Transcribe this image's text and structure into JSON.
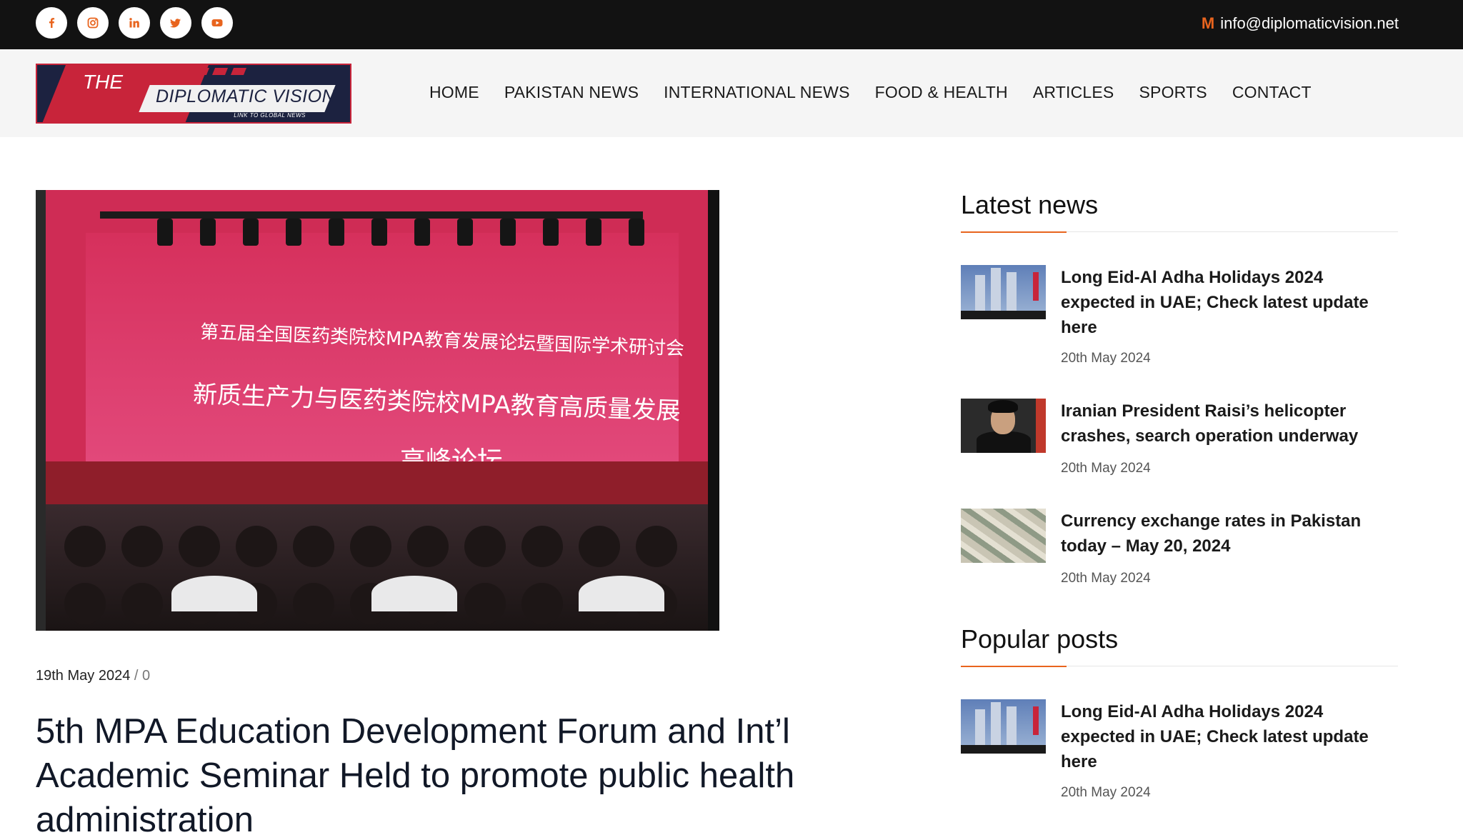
{
  "topbar": {
    "social": [
      {
        "name": "facebook-icon"
      },
      {
        "name": "instagram-icon"
      },
      {
        "name": "linkedin-icon"
      },
      {
        "name": "twitter-icon"
      },
      {
        "name": "youtube-icon"
      }
    ],
    "email": "info@diplomaticvision.net",
    "accent_color": "#e8641e"
  },
  "logo": {
    "line1": "THE",
    "line2": "DIPLOMATIC VISION",
    "tagline": "LINK TO GLOBAL NEWS"
  },
  "nav": [
    "HOME",
    "PAKISTAN NEWS",
    "INTERNATIONAL NEWS",
    "FOOD & HEALTH",
    "ARTICLES",
    "SPORTS",
    "CONTACT"
  ],
  "article": {
    "date": "19th May 2024",
    "separator": "/",
    "comments": "0",
    "title": "5th MPA Education Development Forum and Int’l Academic Seminar Held to promote public health administration",
    "image": {
      "screen_line1": "第五届全国医药类院校MPA教育发展论坛暨国际学术研讨会",
      "screen_line2": "新质生产力与医药类院校MPA教育高质量发展",
      "screen_line3": "高峰论坛"
    }
  },
  "sidebar": {
    "latest_heading": "Latest news",
    "latest": [
      {
        "title": "Long Eid-Al Adha Holidays 2024 expected in UAE; Check latest update here",
        "date": "20th May 2024"
      },
      {
        "title": "Iranian President Raisi’s helicopter crashes, search operation underway",
        "date": "20th May 2024"
      },
      {
        "title": "Currency exchange rates in Pakistan today – May 20, 2024",
        "date": "20th May 2024"
      }
    ],
    "popular_heading": "Popular posts",
    "popular": [
      {
        "title": "Long Eid-Al Adha Holidays 2024 expected in UAE; Check latest update here",
        "date": "20th May 2024"
      }
    ]
  }
}
